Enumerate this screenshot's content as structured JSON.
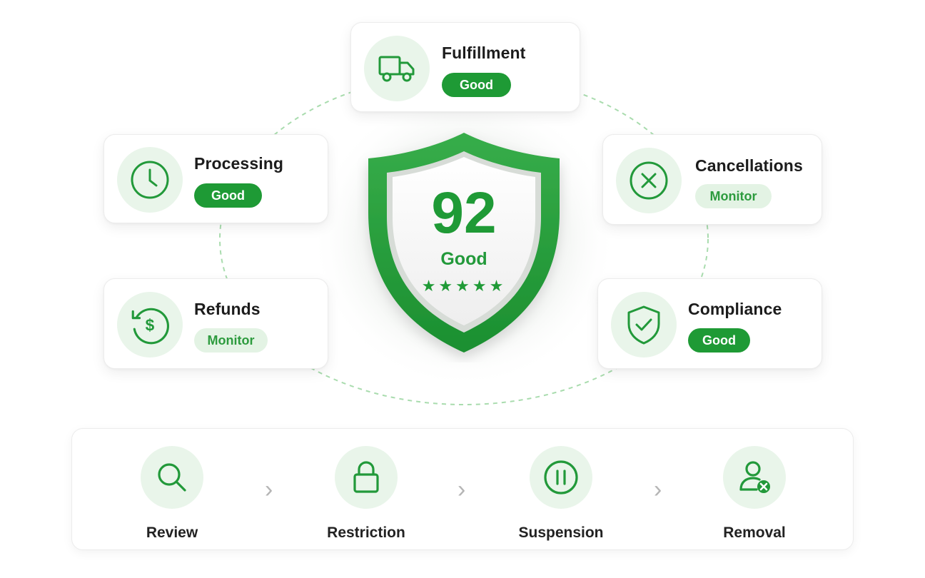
{
  "center": {
    "score": "92",
    "label": "Good",
    "stars": "★★★★★",
    "rating": 5
  },
  "metrics": {
    "fulfillment": {
      "title": "Fulfillment",
      "status": "Good",
      "icon": "truck-icon"
    },
    "processing": {
      "title": "Processing",
      "status": "Good",
      "icon": "clock-icon"
    },
    "cancellations": {
      "title": "Cancellations",
      "status": "Monitor",
      "icon": "x-circle-icon"
    },
    "refunds": {
      "title": "Refunds",
      "status": "Monitor",
      "icon": "refund-dollar-icon"
    },
    "compliance": {
      "title": "Compliance",
      "status": "Good",
      "icon": "shield-check-icon"
    }
  },
  "steps": [
    {
      "label": "Review",
      "icon": "search-icon"
    },
    {
      "label": "Restriction",
      "icon": "lock-icon"
    },
    {
      "label": "Suspension",
      "icon": "pause-icon"
    },
    {
      "label": "Removal",
      "icon": "user-remove-icon"
    }
  ],
  "colors": {
    "accent": "#1e9a35",
    "accent_light": "#e9f5ea",
    "monitor_bg": "#e3f3e4",
    "monitor_text": "#2d9b3e"
  }
}
